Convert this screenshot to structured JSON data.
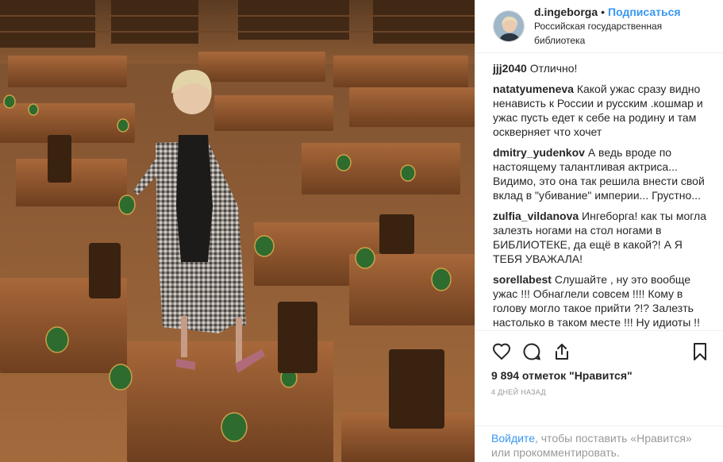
{
  "header": {
    "username": "d.ingeborga",
    "separator": "•",
    "follow_label": "Подписаться",
    "location": "Российская государственная библиотека"
  },
  "comments": [
    {
      "user": "jjj2040",
      "text": "Отлично!"
    },
    {
      "user": "natatyumeneva",
      "text": "Какой ужас сразу видно ненависть к России и русским .кошмар и ужас пусть едет к себе на родину и там оскверняет что хочет"
    },
    {
      "user": "dmitry_yudenkov",
      "text": "А ведь вроде по настоящему талантливая актриса... Видимо, это она так решила внести свой вклад в \"убивание\" империи... Грустно..."
    },
    {
      "user": "zulfia_vildanova",
      "text": "Ингеборга! как ты могла залезть ногами на стол ногами в БИБЛИОТЕКЕ, да ещё в какой?! А Я ТЕБЯ УВАЖАЛА!"
    },
    {
      "user": "sorellabest",
      "text": "Слушайте , ну это вообще ужас !!! Обнаглели совсем !!!! Кому в голову могло такое прийти ?!? Залезть настолько в таком месте !!! Ну идиоты !! Позор !!👎🏻👎🏻👎🏻👎🏻👎🏻👎🏻👎🏻👎🏻"
    }
  ],
  "actions": {
    "like_icon": "heart-icon",
    "comment_icon": "speech-bubble-icon",
    "share_icon": "share-icon",
    "save_icon": "bookmark-icon"
  },
  "likes": "9 894 отметок \"Нравится\"",
  "timestamp": "4 дней назад",
  "footer": {
    "login_link": "Войдите",
    "rest_text": ", чтобы поставить «Нравится» или прокомментировать."
  },
  "colors": {
    "link": "#3897f0",
    "text": "#262626",
    "muted": "#999999",
    "divider": "#efefef"
  }
}
